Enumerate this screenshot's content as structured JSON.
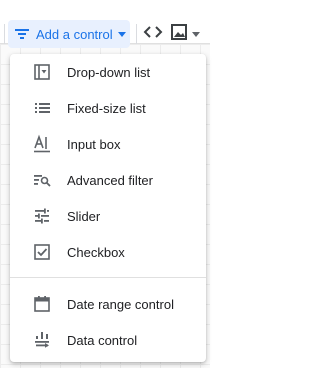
{
  "toolbar": {
    "add_control_label": "Add a control",
    "add_control_icon": "filter-list-icon",
    "code_icon": "code-brackets-icon",
    "image_icon": "image-icon",
    "accent_color": "#1a73e8",
    "accent_bg": "#e8f0fe"
  },
  "menu": {
    "items": [
      {
        "label": "Drop-down list",
        "icon": "dropdown-list-icon"
      },
      {
        "label": "Fixed-size list",
        "icon": "list-icon"
      },
      {
        "label": "Input box",
        "icon": "input-box-icon"
      },
      {
        "label": "Advanced filter",
        "icon": "advanced-filter-icon"
      },
      {
        "label": "Slider",
        "icon": "slider-icon"
      },
      {
        "label": "Checkbox",
        "icon": "checkbox-icon"
      },
      {
        "label": "Date range control",
        "icon": "calendar-icon"
      },
      {
        "label": "Data control",
        "icon": "data-control-icon"
      }
    ]
  }
}
